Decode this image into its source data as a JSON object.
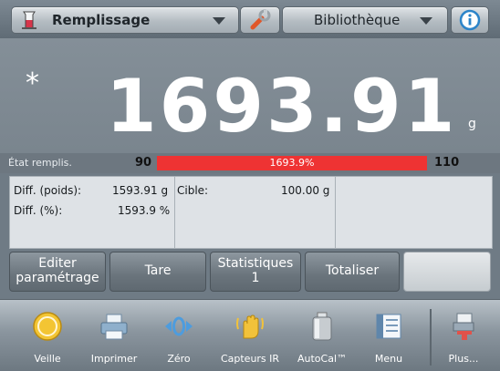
{
  "header": {
    "mode_label": "Remplissage",
    "library_label": "Bibliothèque",
    "icons": [
      "beaker-icon",
      "chevron-down-icon",
      "wrench-icon",
      "chevron-down-icon",
      "info-icon"
    ]
  },
  "display": {
    "stability_marker": "*",
    "weight": "1693.91",
    "unit": "g"
  },
  "fill_state": {
    "label": "État remplis.",
    "min": "90",
    "max": "110",
    "percent_text": "1693.9%",
    "fill_fraction": 1.0,
    "bar_color": "#ee3333"
  },
  "info": {
    "diff_weight_label": "Diff. (poids):",
    "diff_weight_value": "1593.91 g",
    "diff_percent_label": "Diff. (%):",
    "diff_percent_value": "1593.9 %",
    "target_label": "Cible:",
    "target_value": "100.00 g"
  },
  "actions": {
    "edit_line1": "Editer",
    "edit_line2": "paramétrage",
    "tare": "Tare",
    "stats_line1": "Statistiques",
    "stats_line2": "1",
    "totalize": "Totaliser"
  },
  "nav": {
    "items": [
      {
        "label": "Veille",
        "icon": "power-icon"
      },
      {
        "label": "Imprimer",
        "icon": "printer-icon"
      },
      {
        "label": "Zéro",
        "icon": "zero-icon"
      },
      {
        "label": "Capteurs IR",
        "icon": "hand-sensor-icon"
      },
      {
        "label": "AutoCal™",
        "icon": "calibration-weight-icon"
      },
      {
        "label": "Menu",
        "icon": "menu-list-icon"
      },
      {
        "label": "Plus...",
        "icon": "more-icon"
      }
    ]
  }
}
